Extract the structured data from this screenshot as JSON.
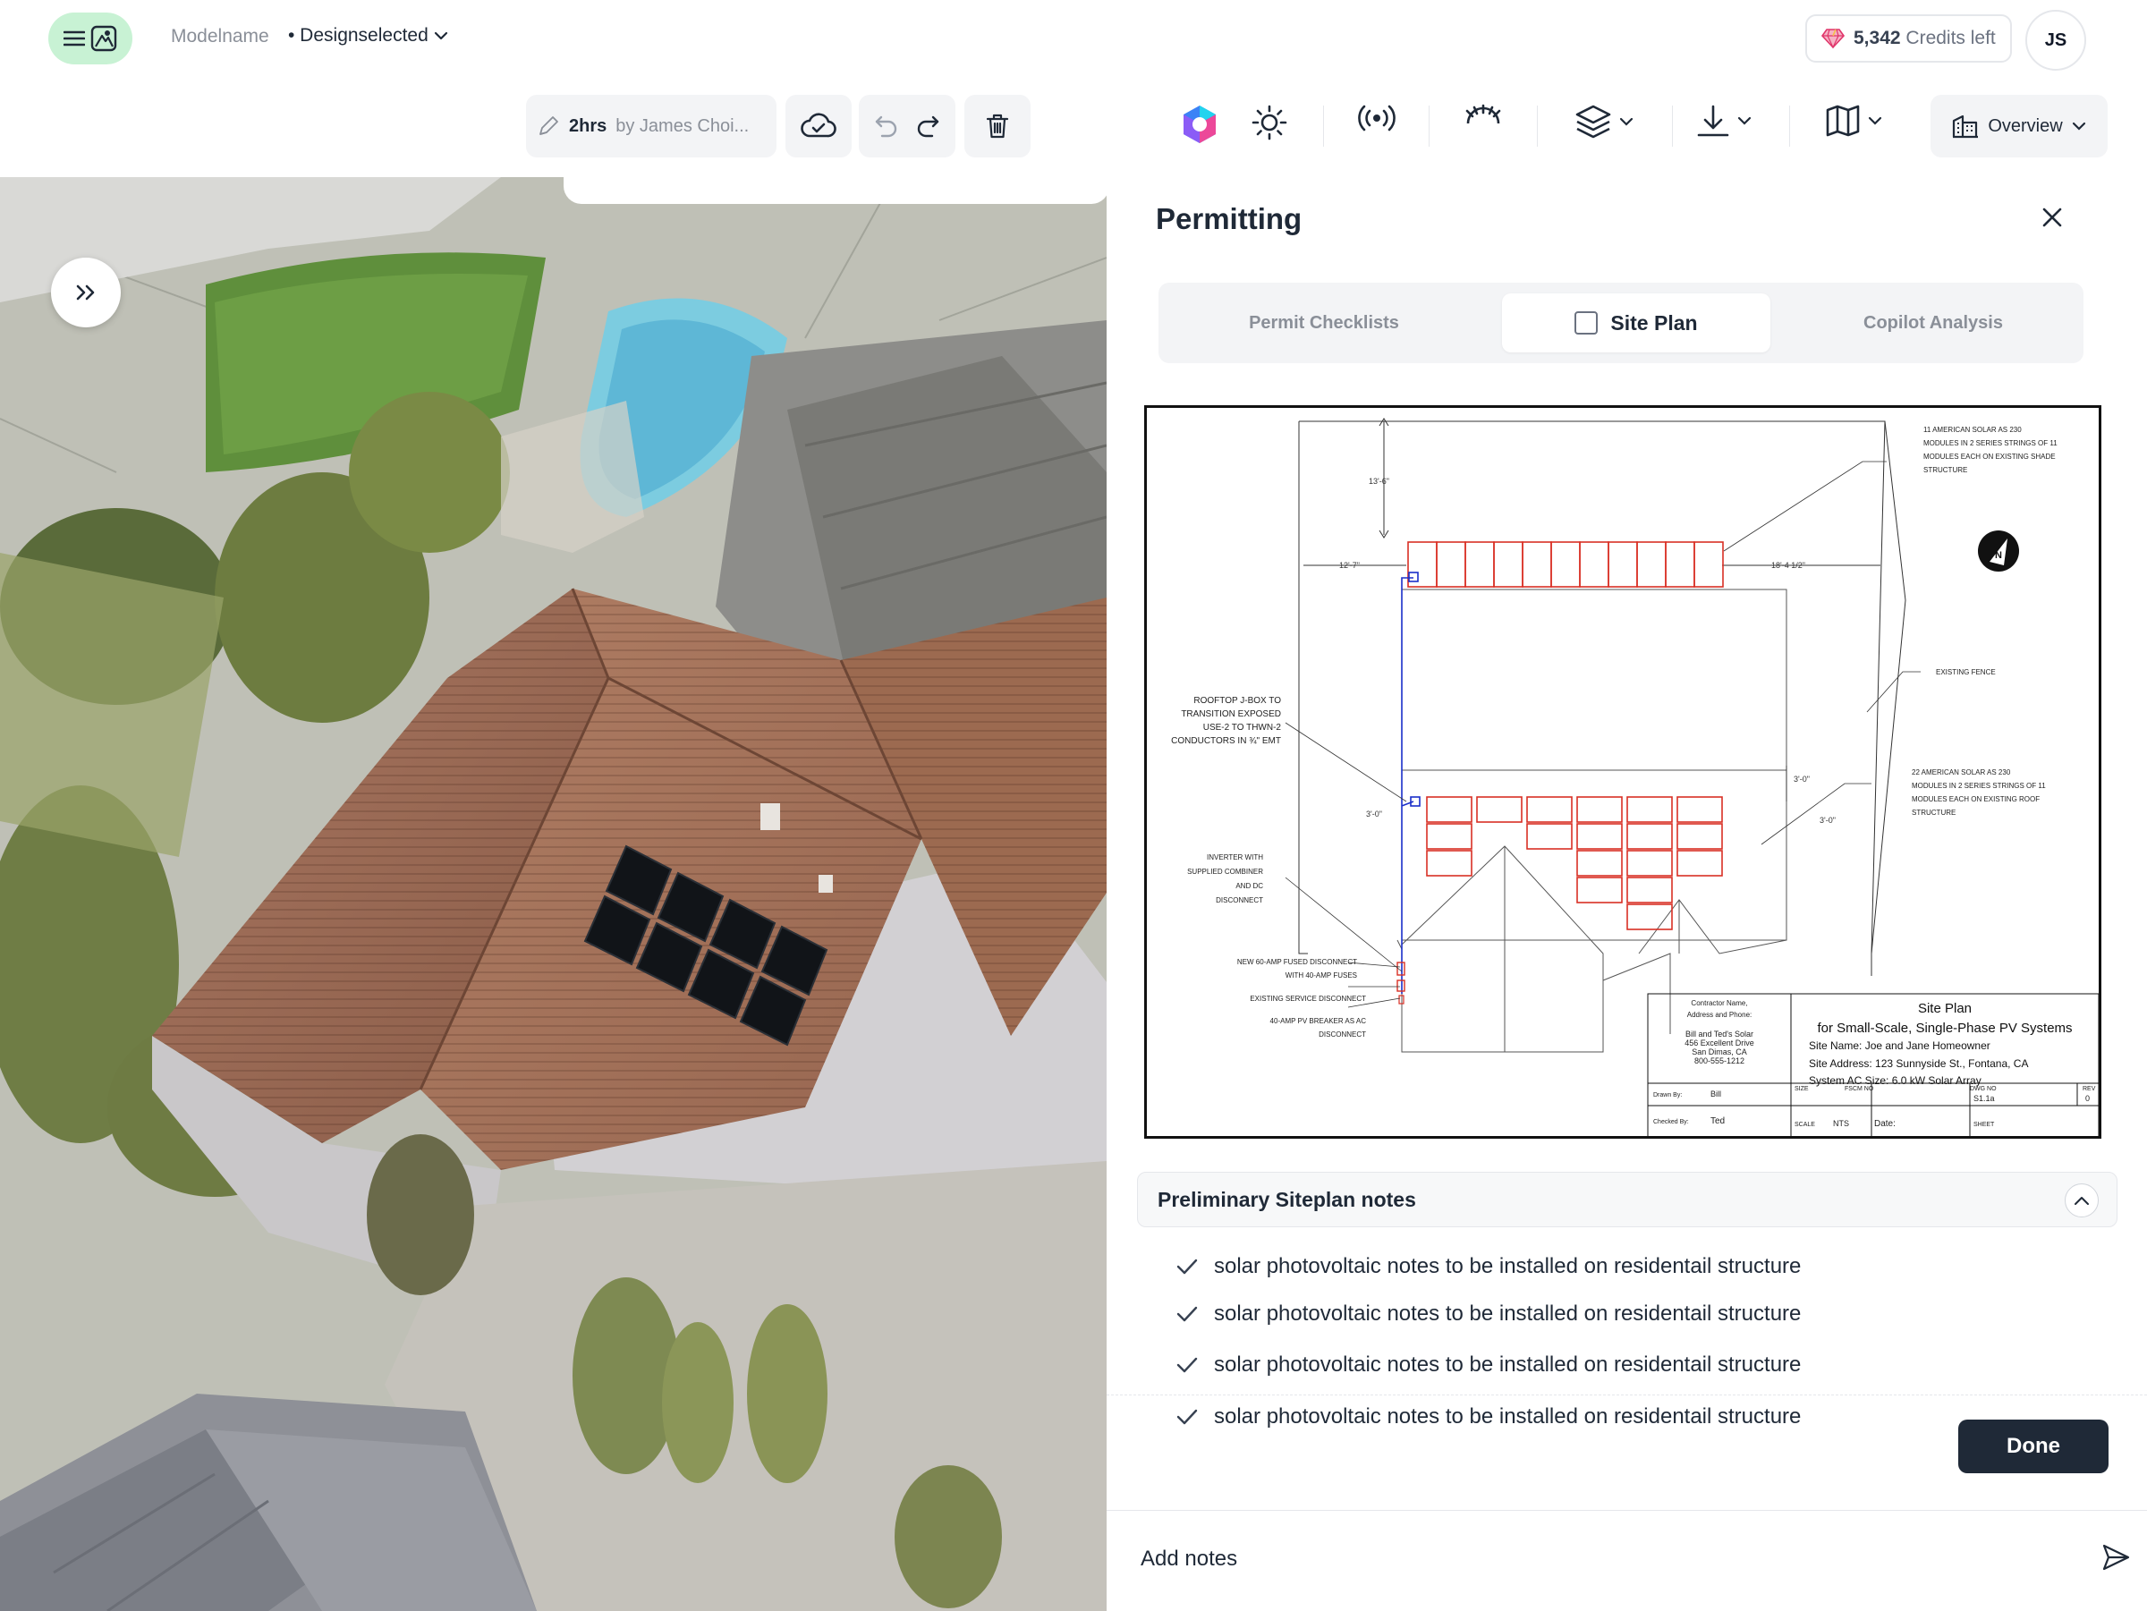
{
  "header": {
    "model_name": "Modelname",
    "design_selected": "• Designselected",
    "credits_count": "5,342",
    "credits_label": "Credits left",
    "user_initials": "JS"
  },
  "toolbar": {
    "edit_time": "2hrs",
    "edit_by": "by James Choi...",
    "overview_label": "Overview"
  },
  "panel": {
    "title": "Permitting",
    "tabs": [
      {
        "label": "Permit Checklists",
        "active": false
      },
      {
        "label": "Site Plan",
        "active": true
      },
      {
        "label": "Copilot Analysis",
        "active": false
      }
    ],
    "notes_header": "Preliminary Siteplan notes",
    "notes": [
      "solar photovoltaic notes to be installed on residentail structure",
      "solar photovoltaic notes to be installed on residentail structure",
      "solar photovoltaic notes to be installed on residentail structure",
      "solar photovoltaic notes to be installed on residentail structure"
    ],
    "done_label": "Done",
    "add_notes_placeholder": "Add notes"
  },
  "site_plan": {
    "dims": {
      "top": "13'-6\"",
      "left": "12'-7\"",
      "right": "18'-4 1/2\"",
      "mid_right_a": "3'-0\"",
      "mid_right_b": "3'-0\"",
      "mid_left": "3'-0\""
    },
    "callouts": {
      "shade_structure": [
        "11 AMERICAN SOLAR AS 230",
        "MODULES IN 2 SERIES STRINGS OF 11",
        "MODULES EACH ON EXISTING SHADE",
        "STRUCTURE"
      ],
      "fence": "EXISTING FENCE",
      "roof_structure": [
        "22 AMERICAN SOLAR AS 230",
        "MODULES IN 2 SERIES STRINGS OF 11",
        "MODULES EACH ON EXISTING ROOF",
        "STRUCTURE"
      ],
      "jbox": [
        "ROOFTOP J-BOX TO",
        "TRANSITION EXPOSED",
        "USE-2 TO THWN-2",
        "CONDUCTORS IN ¾\" EMT"
      ],
      "inverter": [
        "INVERTER WITH",
        "SUPPLIED COMBINER",
        "AND DC",
        "DISCONNECT"
      ],
      "fused_disconnect": [
        "NEW 60-AMP FUSED DISCONNECT",
        "WITH 40-AMP FUSES"
      ],
      "service_disconnect": "EXISTING SERVICE DISCONNECT",
      "pv_breaker": [
        "40-AMP PV BREAKER AS AC",
        "DISCONNECT"
      ]
    },
    "title_block": {
      "contractor_label": [
        "Contractor Name,",
        "Address and Phone:"
      ],
      "contractor": [
        "Bill and Ted's Solar",
        "456 Excellent Drive",
        "San Dimas, CA",
        "800-555-1212"
      ],
      "title": "Site Plan",
      "subtitle": "for Small-Scale, Single-Phase PV Systems",
      "site_name": "Site Name: Joe and Jane Homeowner",
      "site_address": "Site Address: 123 Sunnyside St., Fontana, CA",
      "system_size": "System AC Size: 6.0 kW Solar Array",
      "drawn_by_label": "Drawn By:",
      "drawn_by": "Bill",
      "checked_by_label": "Checked By:",
      "checked_by": "Ted",
      "size_label": "SIZE",
      "fscm_label": "FSCM NO",
      "dwg_label": "DWG NO",
      "rev_label": "REV",
      "dwg_no": "S1.1a",
      "rev": "0",
      "scale_label": "SCALE",
      "scale": "NTS",
      "date_label": "Date:",
      "sheet_label": "SHEET"
    },
    "north": "N"
  },
  "colors": {
    "accent_green": "#c8f2d4",
    "dark_button": "#1f2937",
    "panel_red": "#d93025",
    "wire_blue": "#1a2fc9"
  },
  "icons": [
    "menu-icon",
    "logo-icon",
    "chevron-down-icon",
    "gem-icon",
    "pencil-icon",
    "cloud-icon",
    "undo-icon",
    "redo-icon",
    "trash-icon",
    "hexagon-logo-icon",
    "sun-icon",
    "broadcast-icon",
    "horizon-icon",
    "layers-icon",
    "download-icon",
    "map-icon",
    "building-icon",
    "close-icon",
    "chevron-up-icon",
    "check-icon",
    "send-icon",
    "double-chevron-right-icon"
  ]
}
